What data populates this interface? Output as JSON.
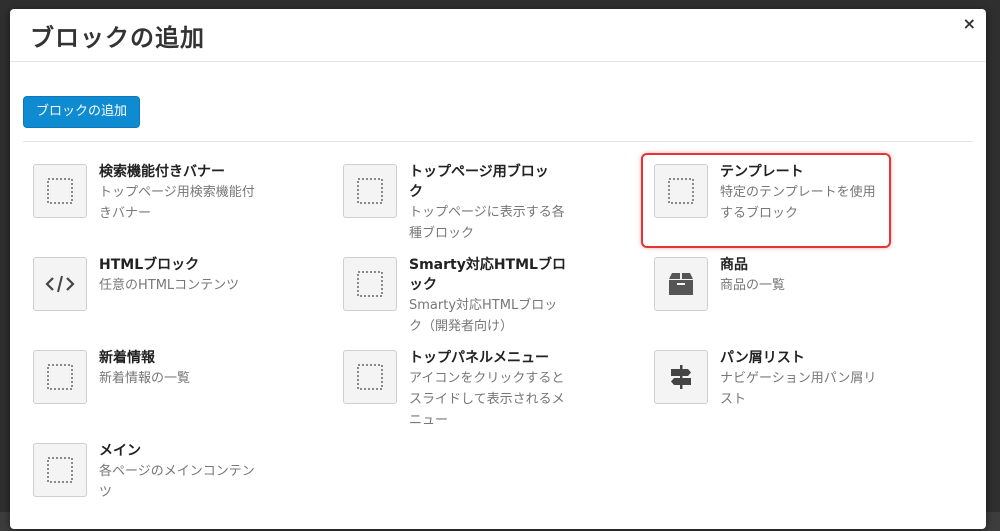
{
  "modal": {
    "title": "ブロックの追加",
    "close_label": "×",
    "add_button_label": "ブロックの追加"
  },
  "blocks": [
    {
      "name": "検索機能付きバナー",
      "desc": "トップページ用検索機能付きバナー",
      "icon": "dotted-square-icon"
    },
    {
      "name": "トップページ用ブロック",
      "desc": "トップページに表示する各種ブロック",
      "icon": "dotted-square-icon"
    },
    {
      "name": "テンプレート",
      "desc": "特定のテンプレートを使用するブロック",
      "icon": "dotted-square-icon"
    },
    {
      "name": "HTMLブロック",
      "desc": "任意のHTMLコンテンツ",
      "icon": "code-icon"
    },
    {
      "name": "Smarty対応HTMLブロック",
      "desc": "Smarty対応HTMLブロック（開発者向け）",
      "icon": "dotted-square-icon"
    },
    {
      "name": "商品",
      "desc": "商品の一覧",
      "icon": "box-icon"
    },
    {
      "name": "新着情報",
      "desc": "新着情報の一覧",
      "icon": "dotted-square-icon"
    },
    {
      "name": "トップパネルメニュー",
      "desc": "アイコンをクリックするとスライドして表示されるメニュー",
      "icon": "dotted-square-icon"
    },
    {
      "name": "パン屑リスト",
      "desc": "ナビゲーション用パン屑リスト",
      "icon": "signpost-icon"
    },
    {
      "name": "メイン",
      "desc": "各ページのメインコンテンツ",
      "icon": "dotted-square-icon"
    }
  ],
  "colors": {
    "button": "#0e8bd1",
    "highlight": "#e23535"
  }
}
